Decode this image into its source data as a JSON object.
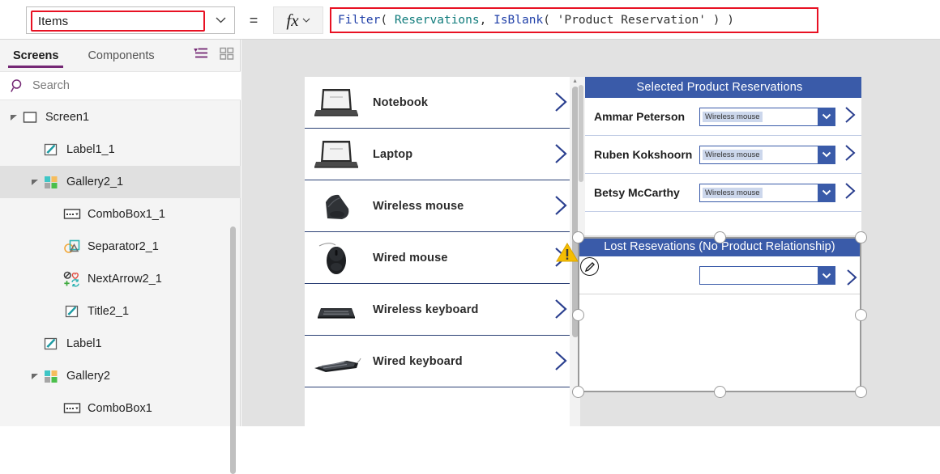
{
  "formula_bar": {
    "property_value": "Items",
    "property_caret_icon": "chevron-down-icon",
    "equals_label": "=",
    "fx_label": "ƒx",
    "fx_caret_icon": "chevron-down-icon",
    "formula_tokens": [
      {
        "text": "Filter",
        "kind": "fn"
      },
      {
        "text": "( ",
        "kind": "pun"
      },
      {
        "text": "Reservations",
        "kind": "tbl"
      },
      {
        "text": ", ",
        "kind": "pun"
      },
      {
        "text": "IsBlank",
        "kind": "fn"
      },
      {
        "text": "( ",
        "kind": "pun"
      },
      {
        "text": "'Product Reservation'",
        "kind": "str"
      },
      {
        "text": " ) )",
        "kind": "pun"
      }
    ],
    "formula_plain": "Filter( Reservations, IsBlank( 'Product Reservation' ) )",
    "highlight_color": "#e81123"
  },
  "sidebar": {
    "tabs": [
      {
        "label": "Screens",
        "active": true
      },
      {
        "label": "Components",
        "active": false
      }
    ],
    "tree_view_icon": "tree-view-icon",
    "thumbnail_view_icon": "thumbnail-view-icon",
    "search": {
      "placeholder": "Search",
      "value": "",
      "icon": "search-icon"
    },
    "accent_color": "#742774",
    "tree": [
      {
        "label": "Screen1",
        "icon": "screen-icon",
        "indent": 0,
        "expanded": true,
        "selected": false
      },
      {
        "label": "Label1_1",
        "icon": "label-icon",
        "indent": 1,
        "expanded": null,
        "selected": false
      },
      {
        "label": "Gallery2_1",
        "icon": "gallery-icon",
        "indent": 1,
        "expanded": true,
        "selected": true
      },
      {
        "label": "ComboBox1_1",
        "icon": "combobox-icon",
        "indent": 2,
        "expanded": null,
        "selected": false
      },
      {
        "label": "Separator2_1",
        "icon": "shapes-icon",
        "indent": 2,
        "expanded": null,
        "selected": false
      },
      {
        "label": "NextArrow2_1",
        "icon": "icons-icon",
        "indent": 2,
        "expanded": null,
        "selected": false
      },
      {
        "label": "Title2_1",
        "icon": "label-icon",
        "indent": 2,
        "expanded": null,
        "selected": false
      },
      {
        "label": "Label1",
        "icon": "label-icon",
        "indent": 1,
        "expanded": null,
        "selected": false
      },
      {
        "label": "Gallery2",
        "icon": "gallery-icon",
        "indent": 1,
        "expanded": true,
        "selected": false
      },
      {
        "label": "ComboBox1",
        "icon": "combobox-icon",
        "indent": 2,
        "expanded": null,
        "selected": false
      }
    ]
  },
  "canvas": {
    "background_color": "#e2e2e2",
    "product_gallery": {
      "chevron_icon": "chevron-right-icon",
      "items": [
        {
          "name": "Notebook",
          "image": "notebook-photo"
        },
        {
          "name": "Laptop",
          "image": "laptop-photo"
        },
        {
          "name": "Wireless mouse",
          "image": "wireless-mouse-photo"
        },
        {
          "name": "Wired mouse",
          "image": "wired-mouse-photo"
        },
        {
          "name": "Wireless keyboard",
          "image": "wireless-keyboard-photo"
        },
        {
          "name": "Wired keyboard",
          "image": "wired-keyboard-photo"
        }
      ]
    },
    "selected_panel": {
      "title": "Selected Product Reservations",
      "title_bg": "#3a5ba9",
      "rows": [
        {
          "person": "Ammar Peterson",
          "product": "Wireless mouse"
        },
        {
          "person": "Ruben Kokshoorn",
          "product": "Wireless mouse"
        },
        {
          "person": "Betsy McCarthy",
          "product": "Wireless mouse"
        }
      ]
    },
    "lost_panel": {
      "title": "Lost Resevations (No Product Relationship)",
      "title_bg": "#3a5ba9",
      "rows": [
        {
          "person": "",
          "product": ""
        }
      ],
      "warning_icon": "warning-triangle-icon",
      "edit_icon": "edit-pencil-icon",
      "selected": true
    }
  }
}
